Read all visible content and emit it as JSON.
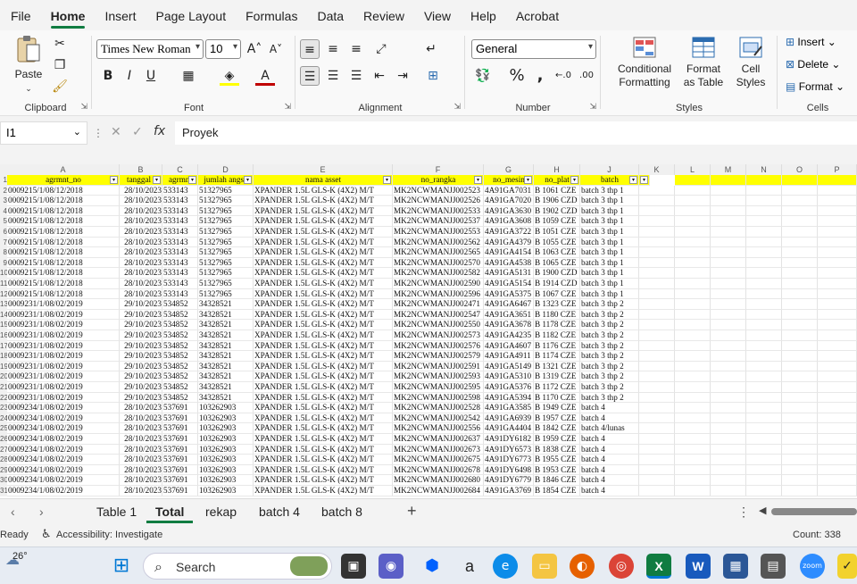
{
  "menu": [
    "File",
    "Home",
    "Insert",
    "Page Layout",
    "Formulas",
    "Data",
    "Review",
    "View",
    "Help",
    "Acrobat"
  ],
  "active_menu": "Home",
  "ribbon": {
    "clipboard": {
      "label": "Clipboard",
      "paste": "Paste"
    },
    "font": {
      "label": "Font",
      "family": "Times New Roman",
      "size": "10"
    },
    "alignment": {
      "label": "Alignment"
    },
    "number": {
      "label": "Number",
      "format": "General"
    },
    "styles": {
      "label": "Styles",
      "conditional": "Conditional Formatting",
      "format_table": "Format as Table",
      "cell_styles": "Cell Styles"
    },
    "cells": {
      "label": "Cells",
      "insert": "Insert",
      "delete": "Delete",
      "format": "Format"
    }
  },
  "formula_bar": {
    "name_box": "I1",
    "content": "Proyek"
  },
  "columns": [
    "A",
    "B",
    "C",
    "D",
    "E",
    "F",
    "G",
    "H",
    "J",
    "K",
    "L",
    "M",
    "N",
    "O",
    "P"
  ],
  "header_row": [
    "agrmnt_no",
    "tanggal j",
    "agrmnt",
    "jumlah angsu",
    "nama asset",
    "no_rangka",
    "no_mesin",
    "no_plat",
    "batch"
  ],
  "rows": [
    [
      "0009215/1/08/12/2018",
      "28/10/2023",
      "533143",
      "51327965",
      "XPANDER 1.5L GLS-K (4X2) M/T",
      "MK2NCWMANJJ002523",
      "4A91GA7031",
      "B 1061 CZE",
      "batch 3 thp 1"
    ],
    [
      "0009215/1/08/12/2018",
      "28/10/2023",
      "533143",
      "51327965",
      "XPANDER 1.5L GLS-K (4X2) M/T",
      "MK2NCWMANJJ002526",
      "4A91GA7020",
      "B 1906 CZD",
      "batch 3 thp 1"
    ],
    [
      "0009215/1/08/12/2018",
      "28/10/2023",
      "533143",
      "51327965",
      "XPANDER 1.5L GLS-K (4X2) M/T",
      "MK2NCWMANJJ002533",
      "4A91GA3630",
      "B 1902 CZD",
      "batch 3 thp 1"
    ],
    [
      "0009215/1/08/12/2018",
      "28/10/2023",
      "533143",
      "51327965",
      "XPANDER 1.5L GLS-K (4X2) M/T",
      "MK2NCWMANJJ002537",
      "4A91GA3608",
      "B 1059 CZE",
      "batch 3 thp 1"
    ],
    [
      "0009215/1/08/12/2018",
      "28/10/2023",
      "533143",
      "51327965",
      "XPANDER 1.5L GLS-K (4X2) M/T",
      "MK2NCWMANJJ002553",
      "4A91GA3722",
      "B 1051 CZE",
      "batch 3 thp 1"
    ],
    [
      "0009215/1/08/12/2018",
      "28/10/2023",
      "533143",
      "51327965",
      "XPANDER 1.5L GLS-K (4X2) M/T",
      "MK2NCWMANJJ002562",
      "4A91GA4379",
      "B 1055 CZE",
      "batch 3 thp 1"
    ],
    [
      "0009215/1/08/12/2018",
      "28/10/2023",
      "533143",
      "51327965",
      "XPANDER 1.5L GLS-K (4X2) M/T",
      "MK2NCWMANJJ002565",
      "4A91GA4154",
      "B 1063 CZE",
      "batch 3 thp 1"
    ],
    [
      "0009215/1/08/12/2018",
      "28/10/2023",
      "533143",
      "51327965",
      "XPANDER 1.5L GLS-K (4X2) M/T",
      "MK2NCWMANJJ002570",
      "4A91GA4538",
      "B 1065 CZE",
      "batch 3 thp 1"
    ],
    [
      "0009215/1/08/12/2018",
      "28/10/2023",
      "533143",
      "51327965",
      "XPANDER 1.5L GLS-K (4X2) M/T",
      "MK2NCWMANJJ002582",
      "4A91GA5131",
      "B 1900 CZD",
      "batch 3 thp 1"
    ],
    [
      "0009215/1/08/12/2018",
      "28/10/2023",
      "533143",
      "51327965",
      "XPANDER 1.5L GLS-K (4X2) M/T",
      "MK2NCWMANJJ002590",
      "4A91GA5154",
      "B 1914 CZD",
      "batch 3 thp 1"
    ],
    [
      "0009215/1/08/12/2018",
      "28/10/2023",
      "533143",
      "51327965",
      "XPANDER 1.5L GLS-K (4X2) M/T",
      "MK2NCWMANJJ002596",
      "4A91GA5375",
      "B 1067 CZE",
      "batch 3 thp 1"
    ],
    [
      "0009231/1/08/02/2019",
      "29/10/2023",
      "534852",
      "34328521",
      "XPANDER 1.5L GLS-K (4X2) M/T",
      "MK2NCWMANJJ002471",
      "4A91GA6467",
      "B 1323 CZE",
      "batch 3 thp 2"
    ],
    [
      "0009231/1/08/02/2019",
      "29/10/2023",
      "534852",
      "34328521",
      "XPANDER 1.5L GLS-K (4X2) M/T",
      "MK2NCWMANJJ002547",
      "4A91GA3651",
      "B 1180 CZE",
      "batch 3 thp 2"
    ],
    [
      "0009231/1/08/02/2019",
      "29/10/2023",
      "534852",
      "34328521",
      "XPANDER 1.5L GLS-K (4X2) M/T",
      "MK2NCWMANJJ002550",
      "4A91GA3678",
      "B 1178 CZE",
      "batch 3 thp 2"
    ],
    [
      "0009231/1/08/02/2019",
      "29/10/2023",
      "534852",
      "34328521",
      "XPANDER 1.5L GLS-K (4X2) M/T",
      "MK2NCWMANJJ002573",
      "4A91GA4235",
      "B 1182 CZE",
      "batch 3 thp 2"
    ],
    [
      "0009231/1/08/02/2019",
      "29/10/2023",
      "534852",
      "34328521",
      "XPANDER 1.5L GLS-K (4X2) M/T",
      "MK2NCWMANJJ002576",
      "4A91GA4607",
      "B 1176 CZE",
      "batch 3 thp 2"
    ],
    [
      "0009231/1/08/02/2019",
      "29/10/2023",
      "534852",
      "34328521",
      "XPANDER 1.5L GLS-K (4X2) M/T",
      "MK2NCWMANJJ002579",
      "4A91GA4911",
      "B 1174 CZE",
      "batch 3 thp 2"
    ],
    [
      "0009231/1/08/02/2019",
      "29/10/2023",
      "534852",
      "34328521",
      "XPANDER 1.5L GLS-K (4X2) M/T",
      "MK2NCWMANJJ002591",
      "4A91GA5149",
      "B 1321 CZE",
      "batch 3 thp 2"
    ],
    [
      "0009231/1/08/02/2019",
      "29/10/2023",
      "534852",
      "34328521",
      "XPANDER 1.5L GLS-K (4X2) M/T",
      "MK2NCWMANJJ002593",
      "4A91GA5310",
      "B 1319 CZE",
      "batch 3 thp 2"
    ],
    [
      "0009231/1/08/02/2019",
      "29/10/2023",
      "534852",
      "34328521",
      "XPANDER 1.5L GLS-K (4X2) M/T",
      "MK2NCWMANJJ002595",
      "4A91GA5376",
      "B 1172 CZE",
      "batch 3 thp 2"
    ],
    [
      "0009231/1/08/02/2019",
      "29/10/2023",
      "534852",
      "34328521",
      "XPANDER 1.5L GLS-K (4X2) M/T",
      "MK2NCWMANJJ002598",
      "4A91GA5394",
      "B 1170 CZE",
      "batch 3 thp 2"
    ],
    [
      "0009234/1/08/02/2019",
      "28/10/2023",
      "537691",
      "103262903",
      "XPANDER 1.5L GLS-K (4X2) M/T",
      "MK2NCWMANJJ002528",
      "4A91GA3585",
      "B 1949 CZE",
      "batch 4"
    ],
    [
      "0009234/1/08/02/2019",
      "28/10/2023",
      "537691",
      "103262903",
      "XPANDER 1.5L GLS-K (4X2) M/T",
      "MK2NCWMANJJ002542",
      "4A91GA6939",
      "B 1957 CZE",
      "batch 4"
    ],
    [
      "0009234/1/08/02/2019",
      "28/10/2023",
      "537691",
      "103262903",
      "XPANDER 1.5L GLS-K (4X2) M/T",
      "MK2NCWMANJJ002556",
      "4A91GA4404",
      "B 1842 CZE",
      "batch 4/lunas"
    ],
    [
      "0009234/1/08/02/2019",
      "28/10/2023",
      "537691",
      "103262903",
      "XPANDER 1.5L GLS-K (4X2) M/T",
      "MK2NCWMANJJ002637",
      "4A91DY6182",
      "B 1959 CZE",
      "batch 4"
    ],
    [
      "0009234/1/08/02/2019",
      "28/10/2023",
      "537691",
      "103262903",
      "XPANDER 1.5L GLS-K (4X2) M/T",
      "MK2NCWMANJJ002673",
      "4A91DY6573",
      "B 1838 CZE",
      "batch 4"
    ],
    [
      "0009234/1/08/02/2019",
      "28/10/2023",
      "537691",
      "103262903",
      "XPANDER 1.5L GLS-K (4X2) M/T",
      "MK2NCWMANJJ002675",
      "4A91DY6773",
      "B 1955 CZE",
      "batch 4"
    ],
    [
      "0009234/1/08/02/2019",
      "28/10/2023",
      "537691",
      "103262903",
      "XPANDER 1.5L GLS-K (4X2) M/T",
      "MK2NCWMANJJ002678",
      "4A91DY6498",
      "B 1953 CZE",
      "batch 4"
    ],
    [
      "0009234/1/08/02/2019",
      "28/10/2023",
      "537691",
      "103262903",
      "XPANDER 1.5L GLS-K (4X2) M/T",
      "MK2NCWMANJJ002680",
      "4A91DY6779",
      "B 1846 CZE",
      "batch 4"
    ],
    [
      "0009234/1/08/02/2019",
      "28/10/2023",
      "537691",
      "103262903",
      "XPANDER 1.5L GLS-K (4X2) M/T",
      "MK2NCWMANJJ002684",
      "4A91GA3769",
      "B 1854 CZE",
      "batch 4"
    ]
  ],
  "row_numbers": [
    "1",
    "2",
    "3",
    "4",
    "5",
    "6",
    "7",
    "8",
    "9",
    "10",
    "11",
    "12",
    "13",
    "14",
    "15",
    "16",
    "17",
    "18",
    "19",
    "20",
    "21",
    "22",
    "23",
    "24",
    "25",
    "26",
    "27",
    "28",
    "29",
    "30",
    "31"
  ],
  "sheet_tabs": [
    "Table 1",
    "Total",
    "rekap",
    "batch 4",
    "batch 8"
  ],
  "active_sheet": "Total",
  "status": {
    "mode": "Ready",
    "accessibility": "Accessibility: Investigate",
    "count": "Count: 338"
  },
  "taskbar": {
    "weather": "26°",
    "search": "Search"
  },
  "colors": {
    "accent": "#107c41",
    "header_fill": "#ffff00",
    "font_color": "#c00000"
  }
}
